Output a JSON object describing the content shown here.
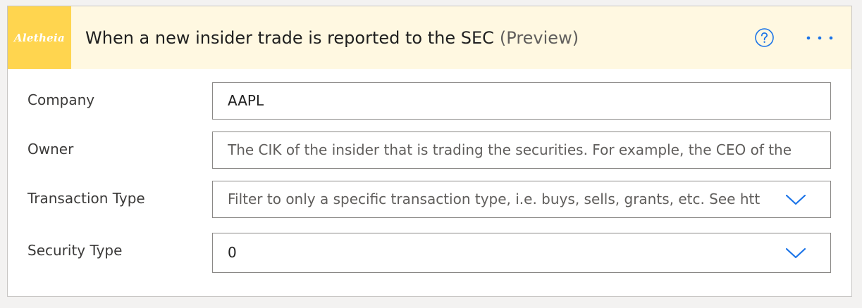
{
  "header": {
    "logo_text": "Aletheia",
    "title": "When a new insider trade is reported to the SEC",
    "preview": "(Preview)",
    "help_icon": "question-circle-icon",
    "more_icon": "ellipsis-icon"
  },
  "fields": {
    "company": {
      "label": "Company",
      "value": "AAPL"
    },
    "owner": {
      "label": "Owner",
      "placeholder": "The CIK of the insider that is trading the securities. For example, the CEO of the"
    },
    "transaction_type": {
      "label": "Transaction Type",
      "placeholder": "Filter to only a specific transaction type, i.e. buys, sells, grants, etc. See htt",
      "icon": "chevron-down-icon"
    },
    "security_type": {
      "label": "Security Type",
      "value": "0",
      "icon": "chevron-down-icon"
    }
  },
  "colors": {
    "header_bg": "#fff8e1",
    "logo_bg": "#ffd54f",
    "accent": "#1a73e8",
    "border": "#8a8886"
  }
}
